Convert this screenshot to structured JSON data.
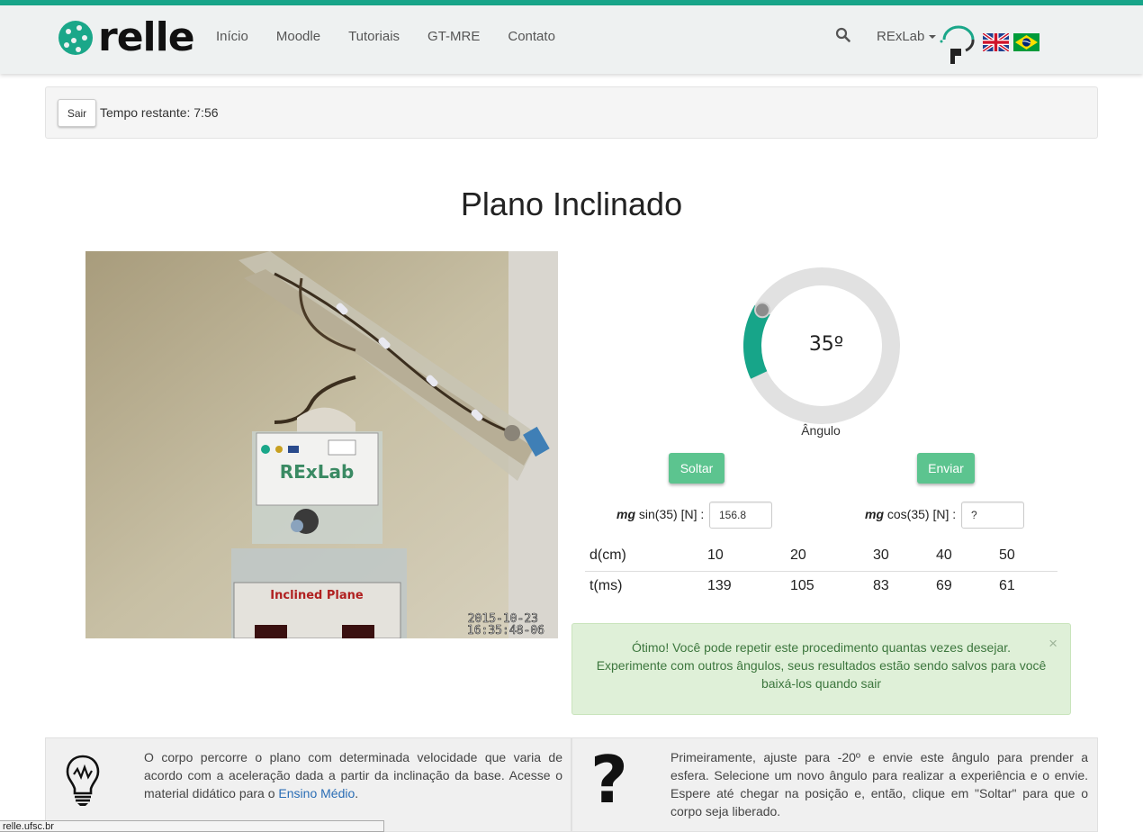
{
  "nav": {
    "brand": "relle",
    "links": [
      "Início",
      "Moodle",
      "Tutoriais",
      "GT-MRE",
      "Contato"
    ],
    "user_menu": "RExLab"
  },
  "session": {
    "exit_label": "Sair",
    "time_remaining": "Tempo restante: 7:56"
  },
  "page": {
    "title": "Plano Inclinado"
  },
  "camera": {
    "sign_label": "RExLab",
    "device_label": "Inclined Plane",
    "timestamp_line1": "2015-10-23",
    "timestamp_line2": "16:35:48-06"
  },
  "gauge": {
    "value": "35º",
    "degrees": 35,
    "label": "Ângulo"
  },
  "controls": {
    "release_label": "Soltar",
    "send_label": "Enviar"
  },
  "forces": {
    "sin_label_var": "mg",
    "sin_label_rest": " sin(35) [N] :",
    "sin_value": "156.8",
    "cos_label_var": "mg",
    "cos_label_rest": " cos(35) [N] :",
    "cos_value": "?"
  },
  "results": {
    "d_label": "d(cm)",
    "d_values": [
      "10",
      "20",
      "30",
      "40",
      "50"
    ],
    "t_label": "t(ms)",
    "t_values": [
      "139",
      "105",
      "83",
      "69",
      "61"
    ]
  },
  "alert": {
    "line1": "Ótimo! Você pode repetir este procedimento quantas vezes desejar.",
    "line2": "Experimente com outros ângulos, seus resultados estão sendo salvos para você",
    "line3": "baixá-los quando sair",
    "close": "×"
  },
  "info": {
    "left_text": "O corpo percorre o plano com determinada velocidade que varia de acordo com a aceleração dada a partir da inclinação da base. Acesse o material didático para o ",
    "left_link": "Ensino Médio",
    "left_end": ".",
    "right_icon": "?",
    "right_text": "Primeiramente, ajuste para -20º e envie este ângulo para prender a esfera. Selecione um novo ângulo para realizar a experiência e o envie. Espere até chegar na posição e, então, clique em \"Soltar\" para que o corpo seja liberado."
  },
  "status_url": "relle.ufsc.br",
  "colors": {
    "accent": "#17a589",
    "button_green": "#5cc48f",
    "alert_bg": "#dff0d8"
  },
  "icons": [
    "search-icon",
    "rexlab-logo-icon",
    "uk-flag-icon",
    "brazil-flag-icon",
    "lightbulb-icon",
    "question-icon"
  ]
}
